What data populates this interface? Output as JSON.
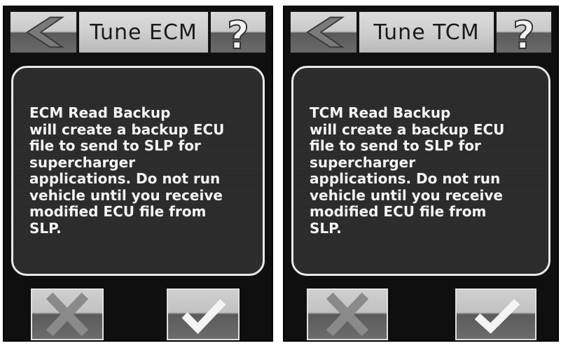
{
  "screens": [
    {
      "title": "Tune ECM",
      "message": "ECM Read Backup\nwill create a backup ECU\nfile to send to SLP for\nsupercharger\napplications.  Do not run\nvehicle until you receive\nmodified ECU file from\nSLP.",
      "help_label": "?"
    },
    {
      "title": "Tune TCM",
      "message": "TCM Read Backup\nwill create a backup ECU\nfile to send to SLP for\nsupercharger\napplications.  Do not run\nvehicle until you receive\nmodified ECU file from\nSLP.",
      "help_label": "?"
    }
  ],
  "icons": {
    "back": "back-arrow-icon",
    "help": "question-mark-icon",
    "cancel": "x-icon",
    "confirm": "checkmark-icon"
  }
}
